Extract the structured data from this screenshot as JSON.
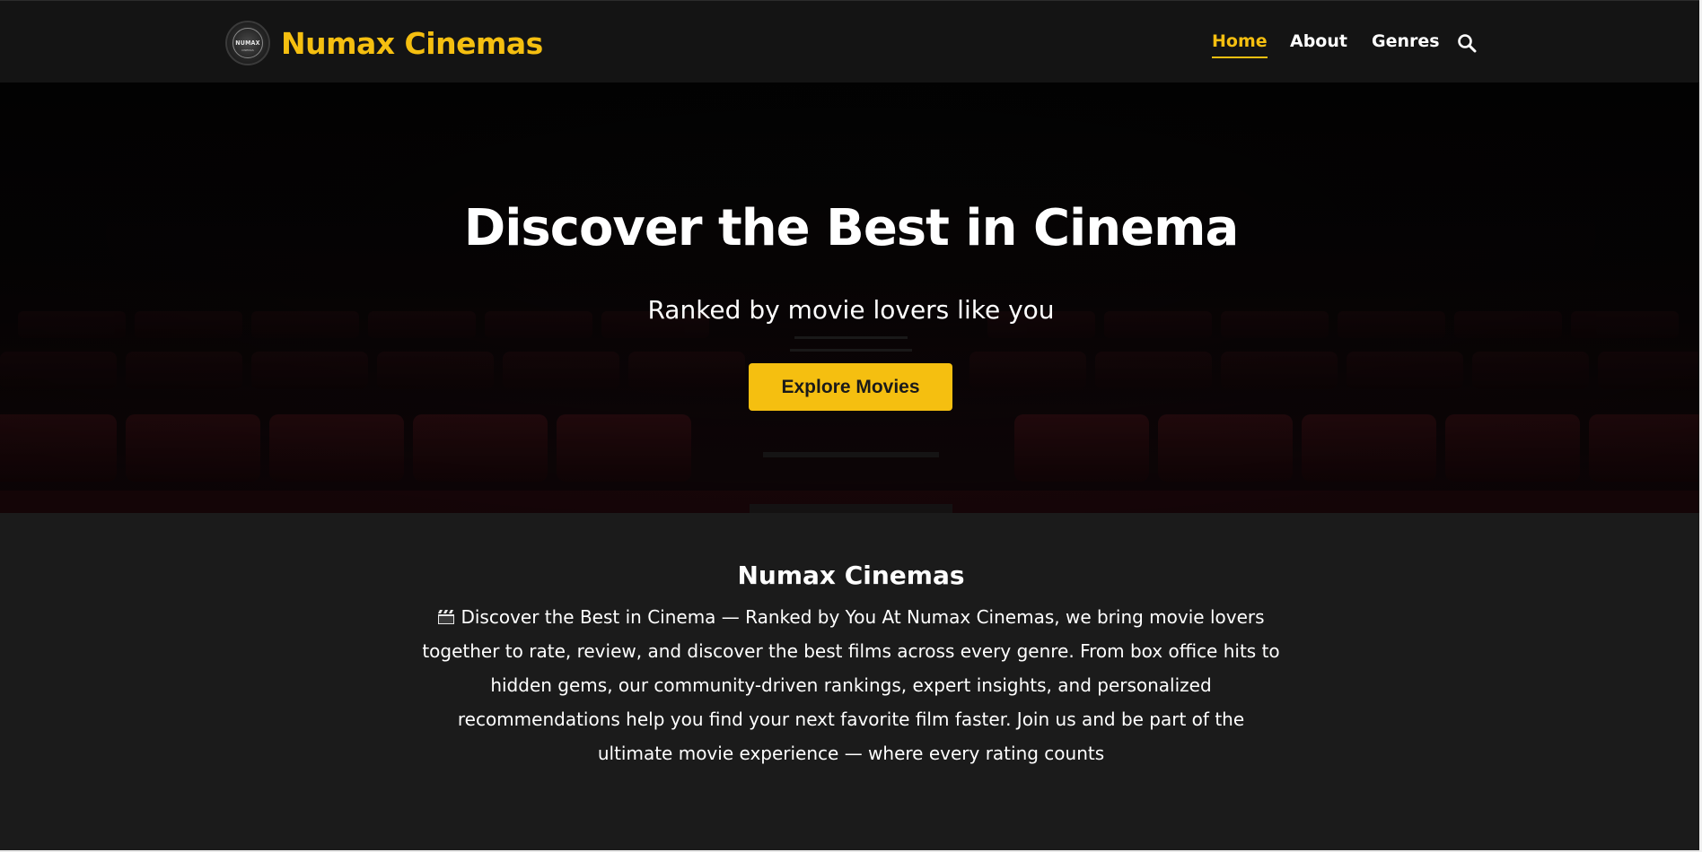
{
  "brand": {
    "logo_text": "NUMAX",
    "logo_subtext": "CINEMAS",
    "name": "Numax Cinemas",
    "accent_color": "#f5bf10"
  },
  "nav": {
    "items": [
      {
        "label": "Home",
        "active": true
      },
      {
        "label": "About",
        "active": false
      },
      {
        "label": "Genres",
        "active": false
      }
    ],
    "search_icon": "search-icon"
  },
  "hero": {
    "title": "Discover the Best in Cinema",
    "subtitle": "Ranked by movie lovers like you",
    "button_label": "Explore Movies",
    "background": "cinema-seats-image"
  },
  "about": {
    "title": "Numax Cinemas",
    "icon": "clapperboard-icon",
    "text": "Discover the Best in Cinema — Ranked by You At Numax Cinemas, we bring movie lovers together to rate, review, and discover the best films across every genre. From box office hits to hidden gems, our community-driven rankings, expert insights, and personalized recommendations help you find your next favorite film faster. Join us and be part of the ultimate movie experience — where every rating counts"
  }
}
